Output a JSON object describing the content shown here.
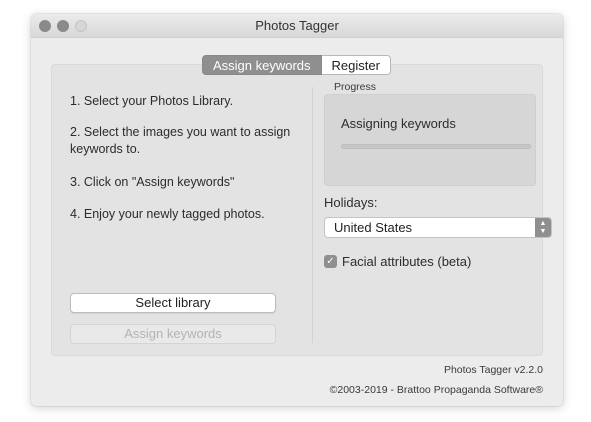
{
  "window": {
    "title": "Photos Tagger"
  },
  "tabs": [
    {
      "label": "Assign keywords",
      "active": true
    },
    {
      "label": "Register",
      "active": false
    }
  ],
  "instructions": {
    "steps": [
      "1. Select your Photos Library.",
      "2. Select the images you want to assign keywords to.",
      "3. Click on \"Assign keywords\"",
      "4. Enjoy your newly tagged photos."
    ]
  },
  "buttons": {
    "select_library": "Select library",
    "assign_keywords": "Assign keywords"
  },
  "progress": {
    "label": "Progress",
    "status": "Assigning keywords",
    "fraction": 0
  },
  "holidays": {
    "label": "Holidays:",
    "selected": "United States"
  },
  "facial_attributes": {
    "label": "Facial attributes (beta)",
    "checked": true
  },
  "footer": {
    "version": "Photos Tagger v2.2.0",
    "copyright": "©2003-2019 - Brattoo Propaganda Software®"
  },
  "colors": {
    "window_bg": "#ececec",
    "panel_bg": "#e3e3e3",
    "accent_gray": "#8f8f8f"
  },
  "icons": {
    "window_close": "close-icon",
    "window_minimize": "minimize-icon",
    "window_zoom": "zoom-icon",
    "select_stepper": "up-down-chevron-icon",
    "checkmark": "checkmark-icon"
  }
}
